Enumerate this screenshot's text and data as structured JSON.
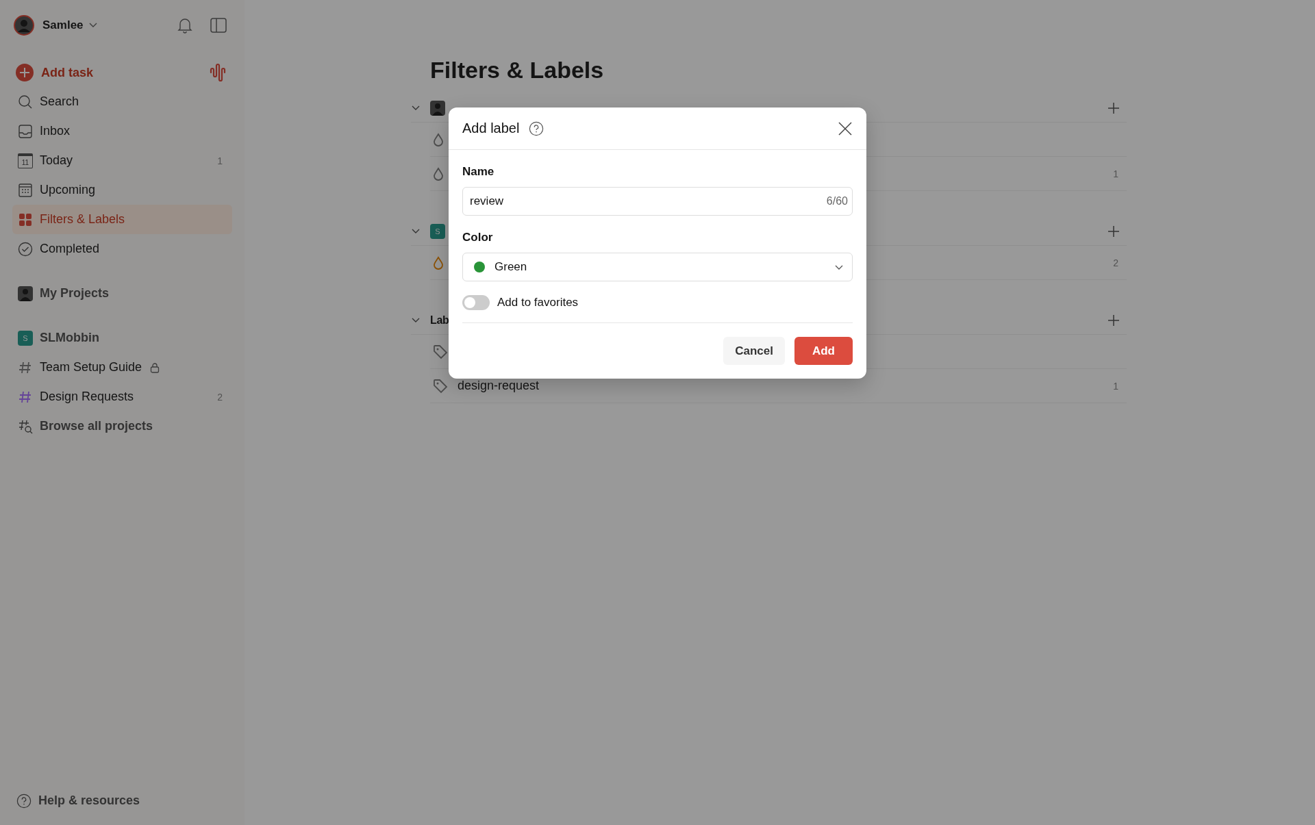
{
  "user": {
    "name": "Samlee"
  },
  "add_task": {
    "label": "Add task"
  },
  "nav": [
    {
      "kind": "search",
      "label": "Search",
      "selected": false
    },
    {
      "kind": "inbox",
      "label": "Inbox",
      "selected": false
    },
    {
      "kind": "today",
      "label": "Today",
      "icon_text": "11",
      "count": "1",
      "selected": false
    },
    {
      "kind": "upcoming",
      "label": "Upcoming",
      "selected": false
    },
    {
      "kind": "filters",
      "label": "Filters & Labels",
      "selected": true
    },
    {
      "kind": "completed",
      "label": "Completed",
      "selected": false
    }
  ],
  "my_projects": {
    "label": "My Projects"
  },
  "team": {
    "badge": "S",
    "label": "SLMobbin",
    "projects": [
      {
        "label": "Team Setup Guide",
        "locked": true,
        "color": "#4d4d4d"
      },
      {
        "label": "Design Requests",
        "locked": false,
        "count": "2",
        "color": "#654399"
      }
    ],
    "browse": "Browse all projects"
  },
  "help": {
    "label": "Help & resources"
  },
  "main": {
    "title": "Filters & Labels",
    "sections": [
      {
        "kind": "user",
        "items": [
          {
            "kind": "filter",
            "color": "#4d4d4d"
          },
          {
            "kind": "filter",
            "color": "#4d4d4d",
            "count": "1"
          }
        ]
      },
      {
        "kind": "team",
        "badge": "S",
        "items": [
          {
            "kind": "filter",
            "color": "#8d5205",
            "count": "2"
          }
        ]
      },
      {
        "kind": "labels",
        "title": "Lab",
        "items": [
          {
            "kind": "label",
            "color": "#4d4d4d"
          },
          {
            "kind": "label",
            "color": "#4d4d4d",
            "name": "design-request",
            "count": "1"
          }
        ]
      }
    ]
  },
  "dialog": {
    "title": "Add label",
    "name_label": "Name",
    "name_value": "review",
    "name_counter": "6/60",
    "color_label": "Color",
    "color_value": "Green",
    "color": "#299438",
    "favorite_label": "Add to favorites",
    "favorite_on": false,
    "buttons": [
      "Cancel",
      "Add"
    ]
  }
}
